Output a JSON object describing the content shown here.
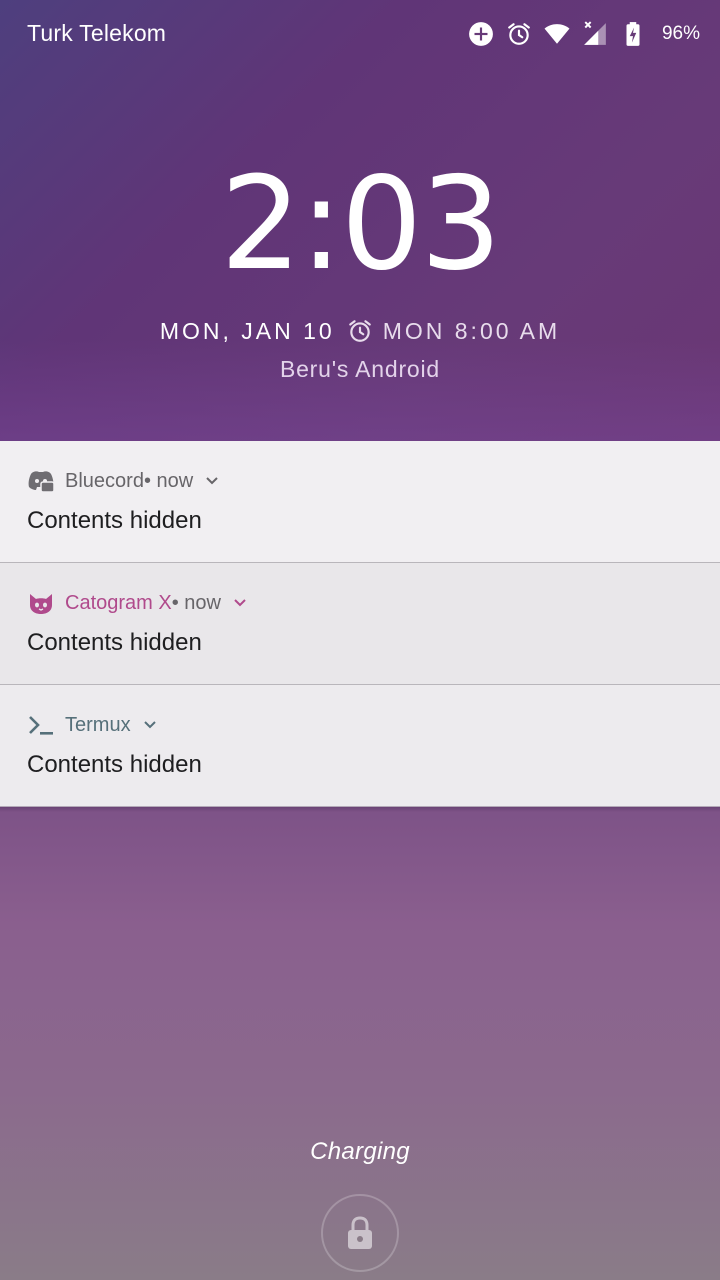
{
  "status_bar": {
    "carrier": "Turk Telekom",
    "battery_percent": "96%",
    "icons": [
      "data-saver-icon",
      "alarm-icon",
      "wifi-icon",
      "cell-signal-no-data-icon",
      "battery-charging-icon"
    ]
  },
  "lockscreen": {
    "time": "2:03",
    "date": "MON, JAN 10",
    "next_alarm": "MON 8:00 AM",
    "owner_info": "Beru's Android",
    "charging_text": "Charging"
  },
  "notifications": [
    {
      "app": "Bluecord",
      "meta": " • now",
      "body": "Contents hidden",
      "app_color": "#676569",
      "icon": "bluecord-icon"
    },
    {
      "app": "Catogram X",
      "meta": " • now",
      "body": "Contents hidden",
      "app_color": "#b04a8c",
      "icon": "cat-icon"
    },
    {
      "app": "Termux",
      "meta": "",
      "body": "Contents hidden",
      "app_color": "#56707a",
      "icon": "terminal-icon"
    }
  ],
  "colors": {
    "notification_bg": "#efedf0",
    "catogram_accent": "#b04a8c",
    "termux_accent": "#56707a"
  }
}
